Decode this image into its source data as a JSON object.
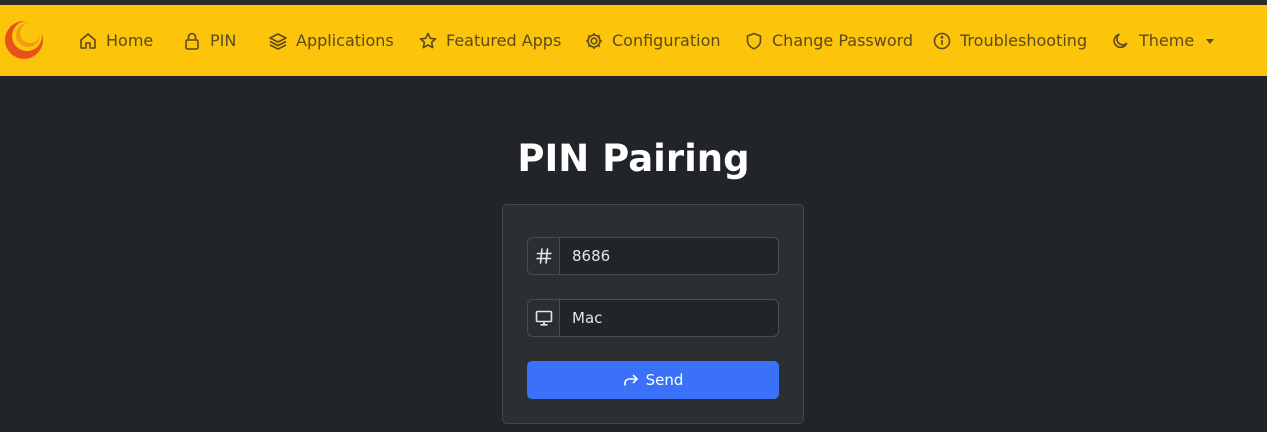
{
  "nav": {
    "items": [
      {
        "label": "Home",
        "icon": "home-icon"
      },
      {
        "label": "PIN",
        "icon": "lock-icon"
      },
      {
        "label": "Applications",
        "icon": "layers-icon"
      },
      {
        "label": "Featured Apps",
        "icon": "star-icon"
      },
      {
        "label": "Configuration",
        "icon": "gear-icon"
      },
      {
        "label": "Change Password",
        "icon": "shield-icon"
      },
      {
        "label": "Troubleshooting",
        "icon": "info-icon"
      },
      {
        "label": "Theme",
        "icon": "moon-icon"
      }
    ]
  },
  "page": {
    "title": "PIN Pairing"
  },
  "form": {
    "pin_value": "8686",
    "pin_icon": "hash-icon",
    "device_value": "Mac",
    "device_icon": "monitor-icon",
    "send_label": "Send",
    "send_icon": "share-arrow-icon"
  },
  "colors": {
    "navbar": "#fcc50b",
    "background": "#212429",
    "card": "#2b2e33",
    "button": "#3b71f8"
  }
}
